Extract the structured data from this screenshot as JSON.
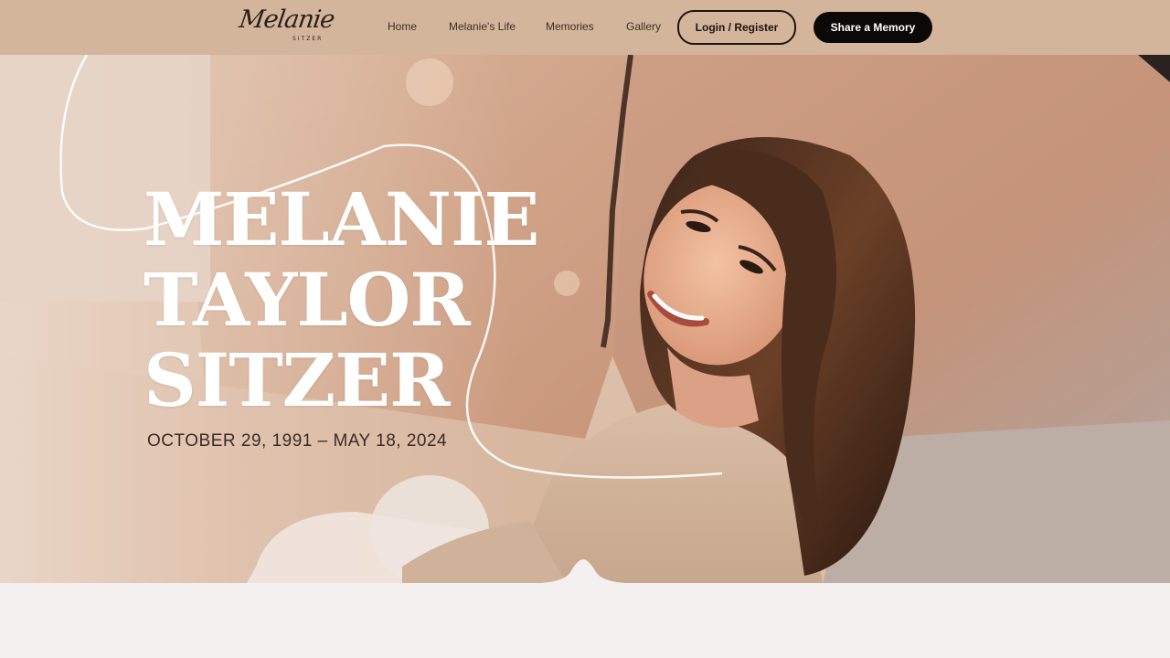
{
  "header": {
    "logo": {
      "script": "Melanie",
      "sub": "SITZER"
    },
    "nav": [
      {
        "label": "Home"
      },
      {
        "label": "Melanie's Life"
      },
      {
        "label": "Memories"
      },
      {
        "label": "Gallery"
      }
    ],
    "login_label": "Login / Register",
    "share_label": "Share a Memory"
  },
  "hero": {
    "name_lines": [
      "MELANIE",
      "TAYLOR",
      "SITZER"
    ],
    "dates": "OCTOBER 29, 1991 – MAY 18, 2024",
    "photo_description": "woman-smiling-in-knit-sweater-against-rocks"
  },
  "colors": {
    "header_bg": "#d3b59b",
    "page_bg": "#f3f0ef",
    "button_dark": "#0b0908"
  }
}
